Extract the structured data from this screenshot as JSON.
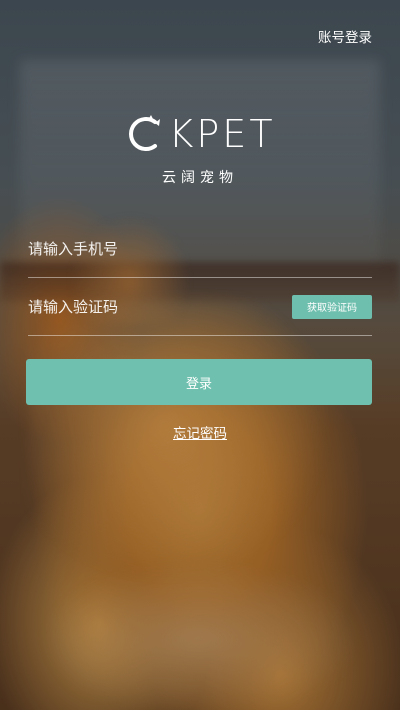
{
  "header": {
    "account_login_label": "账号登录"
  },
  "logo": {
    "brand_text": "KPET",
    "subtitle": "云阔宠物",
    "mark_icon": "cat-c-logo-icon"
  },
  "form": {
    "phone_placeholder": "请输入手机号",
    "code_placeholder": "请输入验证码",
    "get_code_label": "获取验证码",
    "login_label": "登录",
    "forgot_label": "忘记密码"
  },
  "colors": {
    "accent": "#6fc0ae",
    "text": "#ffffff"
  }
}
